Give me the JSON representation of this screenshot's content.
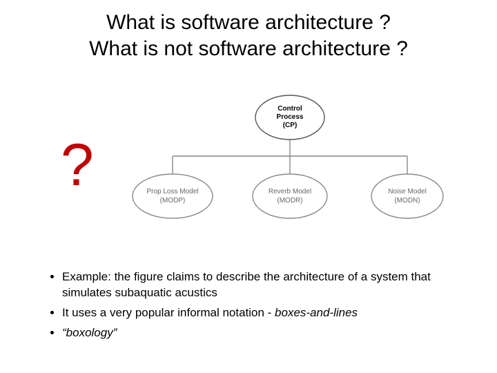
{
  "title_line1": "What is software architecture ?",
  "title_line2": "What is not software architecture ?",
  "big_mark": "?",
  "diagram": {
    "root": {
      "line1": "Control",
      "line2": "Process",
      "line3": "(CP)"
    },
    "child_left": {
      "line1": "Prop Loss Model",
      "line2": "(MODP)"
    },
    "child_mid": {
      "line1": "Reverb Model",
      "line2": "(MODR)"
    },
    "child_right": {
      "line1": "Noise Model",
      "line2": "(MODN)"
    }
  },
  "bullets": {
    "b1_a": "Example:  the figure  claims to describe the architecture of a system that simulates subaquatic acustics",
    "b2_a": "It uses a very popular informal notation -  ",
    "b2_b": "boxes-and-lines",
    "b3_a": "“boxology”"
  }
}
